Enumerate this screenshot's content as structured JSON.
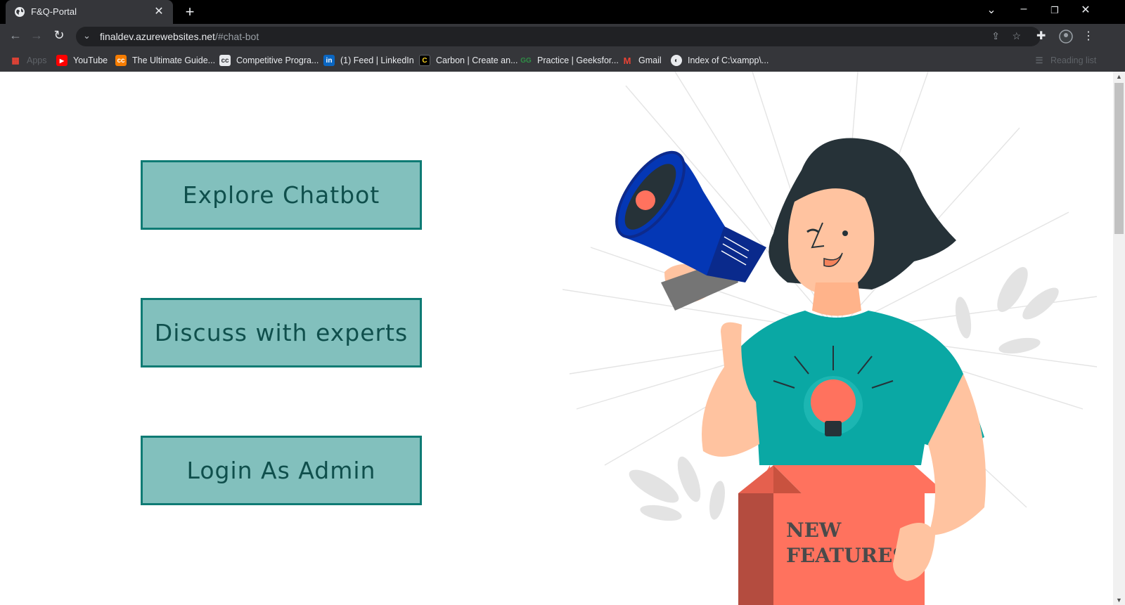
{
  "browser": {
    "tab_title": "F&Q-Portal",
    "tab_close": "✕",
    "new_tab": "+",
    "url_host": "finaldev.azurewebsites.net",
    "url_path": "/#chat-bot",
    "bookmarks": [
      {
        "label": "Apps",
        "icon": "apps-grid-icon",
        "color": "#ea4335"
      },
      {
        "label": "YouTube",
        "icon": "youtube-icon",
        "color": "#ff0000"
      },
      {
        "label": "The Ultimate Guide...",
        "icon": "cc-icon",
        "color": "#f57c00"
      },
      {
        "label": "Competitive Progra...",
        "icon": "cc-icon",
        "color": "#5f6368"
      },
      {
        "label": "(1) Feed | LinkedIn",
        "icon": "linkedin-icon",
        "color": "#0a66c2"
      },
      {
        "label": "Carbon | Create an...",
        "icon": "carbon-icon",
        "color": "#000000"
      },
      {
        "label": "Practice | Geeksfor...",
        "icon": "gfg-icon",
        "color": "#2f8d46"
      },
      {
        "label": "Gmail",
        "icon": "gmail-icon",
        "color": "#ea4335"
      },
      {
        "label": "Index of C:\\xampp\\...",
        "icon": "globe-icon",
        "color": "#e8eaed"
      }
    ],
    "reading_list": "Reading list"
  },
  "page": {
    "buttons": [
      {
        "label": "Explore Chatbot"
      },
      {
        "label": "Discuss with experts"
      },
      {
        "label": "Login As Admin"
      }
    ],
    "illustration": {
      "box_text_line1": "NEW",
      "box_text_line2": "FEATURES"
    }
  },
  "colors": {
    "button_bg": "#82c0bd",
    "button_border": "#0e7b74",
    "button_text": "#0f4f4c",
    "shirt": "#0aa8a4",
    "box": "#ff725e",
    "megaphone": "#0437b5"
  }
}
